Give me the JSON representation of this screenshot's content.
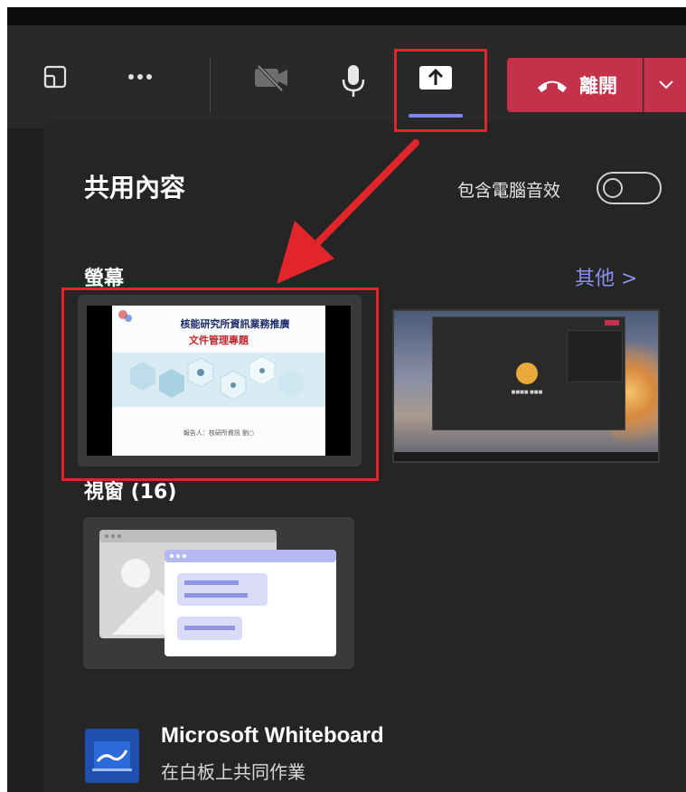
{
  "toolbar": {
    "leave_label": "離開",
    "buttons": [
      {
        "name": "layout",
        "icon": "layout-icon"
      },
      {
        "name": "more",
        "icon": "more-icon"
      },
      {
        "name": "camera",
        "icon": "camera-off-icon"
      },
      {
        "name": "mic",
        "icon": "mic-icon"
      },
      {
        "name": "share",
        "icon": "share-tray-icon",
        "active": true
      }
    ]
  },
  "share_panel": {
    "title": "共用內容",
    "include_audio_label": "包含電腦音效",
    "include_audio_on": false,
    "screen_section": "螢幕",
    "more_link": "其他 >",
    "windows_section": "視窗 (16)",
    "screen1": {
      "slide_title": "核能研究所資訊業務推廣",
      "slide_subtitle": "文件管理專題",
      "slide_footer": "報告人：核研所資訊 劉○"
    },
    "screen2": {
      "caller_label": "■■■■ ■■■"
    },
    "whiteboard": {
      "title": "Microsoft Whiteboard",
      "subtitle": "在白板上共同作業"
    }
  },
  "colors": {
    "accent": "#7f85f5",
    "leave": "#c4314b",
    "highlight": "#e1252b",
    "panel_bg": "#252525"
  }
}
